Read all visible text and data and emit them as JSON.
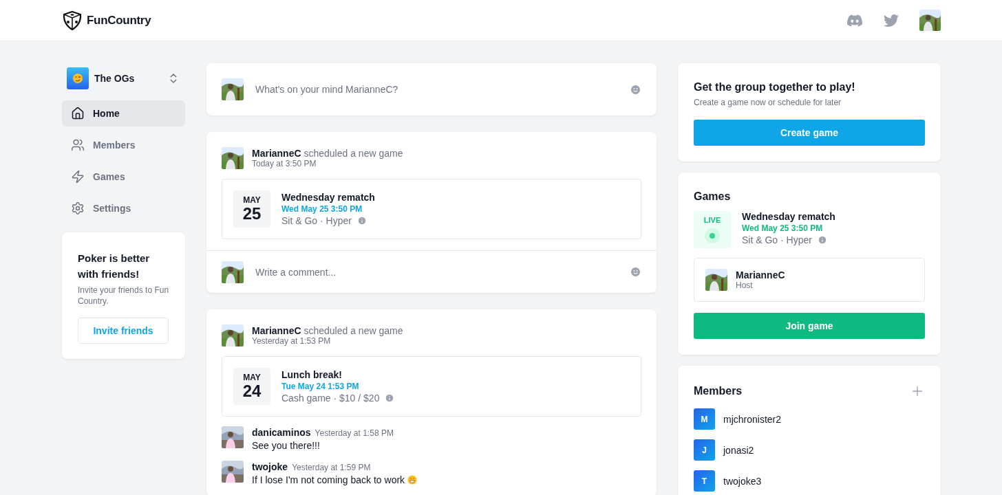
{
  "header": {
    "brand": "FunCountry"
  },
  "sidebar": {
    "group": {
      "name": "The OGs"
    },
    "nav": [
      {
        "label": "Home",
        "kind": "home",
        "selected": true
      },
      {
        "label": "Members",
        "kind": "members",
        "selected": false
      },
      {
        "label": "Games",
        "kind": "games",
        "selected": false
      },
      {
        "label": "Settings",
        "kind": "settings",
        "selected": false
      }
    ],
    "invite": {
      "title": "Poker is better with friends!",
      "text": "Invite your friends to Fun Country.",
      "button": "Invite friends"
    }
  },
  "composer": {
    "placeholder": "What's on your mind MarianneC?"
  },
  "posts": [
    {
      "author": "MarianneC",
      "action": "scheduled a new game",
      "time": "Today at 3:50 PM",
      "game": {
        "month": "MAY",
        "day": "25",
        "title": "Wednesday rematch",
        "when": "Wed May 25 3:50 PM",
        "details": "Sit & Go · Hyper"
      },
      "comment_field": {
        "placeholder": "Write a comment..."
      }
    },
    {
      "author": "MarianneC",
      "action": "scheduled a new game",
      "time": "Yesterday at 1:53 PM",
      "game": {
        "month": "MAY",
        "day": "24",
        "title": "Lunch break!",
        "when": "Tue May 24 1:53 PM",
        "details": "Cash game · $10 / $20"
      },
      "comments": [
        {
          "author": "danicaminos",
          "time": "Yesterday at 1:58 PM",
          "text": "See you there!!!",
          "emoji": false
        },
        {
          "author": "twojoke",
          "time": "Yesterday at 1:59 PM",
          "text": "If I lose I'm not coming back to work",
          "emoji": true
        }
      ]
    }
  ],
  "cta": {
    "title": "Get the group together to play!",
    "subtitle": "Create a game now or schedule for later",
    "button": "Create game"
  },
  "games": {
    "title": "Games",
    "items": [
      {
        "status": "LIVE",
        "live": true,
        "title": "Wednesday rematch",
        "when": "Wed May 25 3:50 PM",
        "details": "Sit & Go · Hyper",
        "host": {
          "name": "MarianneC",
          "role": "Host"
        }
      }
    ],
    "button": "Join game"
  },
  "members": {
    "title": "Members",
    "items": [
      {
        "initial": "M",
        "name": "mjchronister2"
      },
      {
        "initial": "J",
        "name": "jonasi2"
      },
      {
        "initial": "T",
        "name": "twojoke3"
      }
    ]
  }
}
